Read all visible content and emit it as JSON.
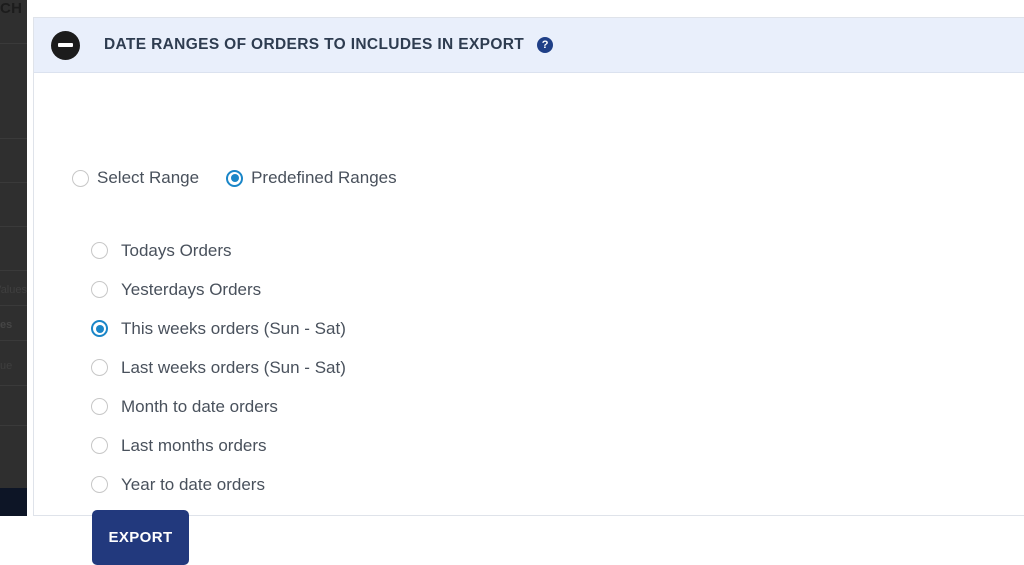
{
  "sidebar": {
    "top_label": "CH",
    "items": [
      {
        "text": "Values..."
      },
      {
        "text": "es"
      },
      {
        "text": "ue"
      }
    ]
  },
  "panel": {
    "header": {
      "collapse_icon": "minus-circle-icon",
      "title": "DATE RANGES OF ORDERS TO INCLUDES IN EXPORT",
      "help_icon": "question-mark-icon",
      "help_glyph": "?",
      "background_color": "#e9effb",
      "title_color": "#2e3c50"
    },
    "mode_options": [
      {
        "label": "Select Range",
        "selected": false
      },
      {
        "label": "Predefined Ranges",
        "selected": true
      }
    ],
    "predefined_options": [
      {
        "label": "Todays Orders",
        "selected": false
      },
      {
        "label": "Yesterdays Orders",
        "selected": false
      },
      {
        "label": "This weeks orders (Sun - Sat)",
        "selected": true
      },
      {
        "label": "Last weeks orders (Sun - Sat)",
        "selected": false
      },
      {
        "label": "Month to date orders",
        "selected": false
      },
      {
        "label": "Last months orders",
        "selected": false
      },
      {
        "label": "Year to date orders",
        "selected": false
      }
    ],
    "export_button": {
      "label": "EXPORT",
      "background_color": "#22397d",
      "text_color": "#ffffff"
    },
    "accent_color": "#1a86c8"
  }
}
